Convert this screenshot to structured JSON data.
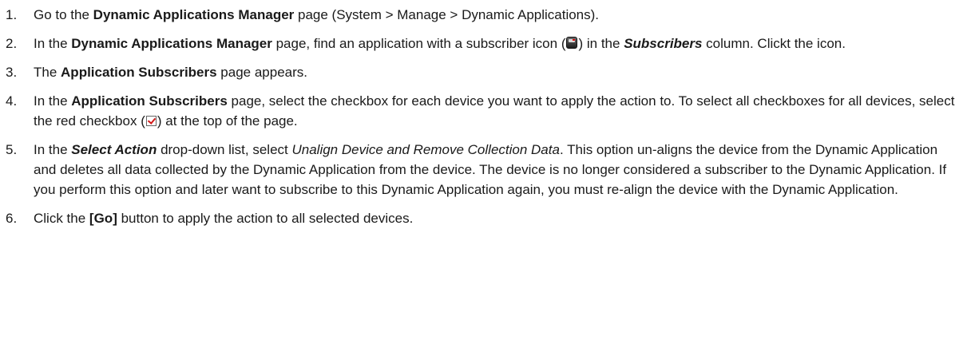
{
  "steps": [
    {
      "number": "1.",
      "t1": "Go to the ",
      "b1": "Dynamic Applications Manager",
      "t2": " page (System > Manage > Dynamic Applications)."
    },
    {
      "number": "2.",
      "t1": "In the ",
      "b1": "Dynamic Applications Manager",
      "t2": " page, find an application with a subscriber icon (",
      "icon": "subscriber-icon",
      "t3": ") in the ",
      "bi1": "Subscribers",
      "t4": " column. Clickt the icon."
    },
    {
      "number": "3.",
      "t1": "The ",
      "b1": "Application Subscribers",
      "t2": " page appears."
    },
    {
      "number": "4.",
      "t1": "In the ",
      "b1": "Application Subscribers",
      "t2": " page, select the checkbox for each device you want to apply the action to. To select all checkboxes for all devices, select the red checkbox (",
      "icon": "red-checkbox-icon",
      "t3": ") at the top of the page."
    },
    {
      "number": "5.",
      "t1": "In the ",
      "bi1": "Select Action",
      "t2": " drop-down list, select ",
      "i1": "Unalign Device and Remove Collection Data",
      "t3": ". This option un-aligns the device from the Dynamic Application and deletes all data collected by the Dynamic Application from the device. The device is no longer considered a subscriber to the Dynamic Application. If you perform this option and later want to subscribe to this Dynamic Application again, you must re-align the device with the Dynamic Application."
    },
    {
      "number": "6.",
      "t1": "Click the ",
      "b1": "[Go]",
      "t2": " button to apply the action to all selected devices."
    }
  ]
}
